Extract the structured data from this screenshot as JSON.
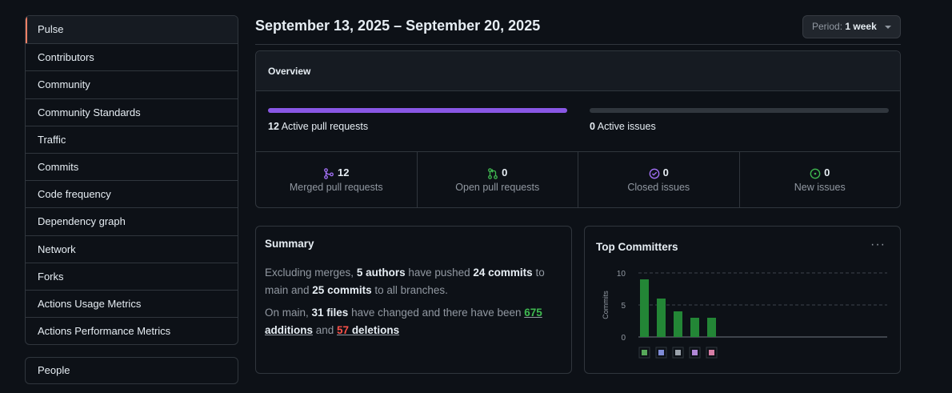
{
  "sidebar": {
    "items": [
      {
        "label": "Pulse",
        "active": true
      },
      {
        "label": "Contributors"
      },
      {
        "label": "Community"
      },
      {
        "label": "Community Standards"
      },
      {
        "label": "Traffic"
      },
      {
        "label": "Commits"
      },
      {
        "label": "Code frequency"
      },
      {
        "label": "Dependency graph"
      },
      {
        "label": "Network"
      },
      {
        "label": "Forks"
      },
      {
        "label": "Actions Usage Metrics"
      },
      {
        "label": "Actions Performance Metrics"
      }
    ],
    "people_label": "People"
  },
  "header": {
    "title": "September 13, 2025 – September 20, 2025",
    "period_prefix": "Period:",
    "period_value": "1 week"
  },
  "overview": {
    "title": "Overview",
    "pull_requests": {
      "count": "12",
      "label": "Active pull requests",
      "fill": 1.0,
      "color": "#8957e5"
    },
    "issues": {
      "count": "0",
      "label": "Active issues",
      "fill": 0,
      "color": "#30363d"
    },
    "stats": [
      {
        "count": "12",
        "label": "Merged pull requests",
        "icon": "merge-icon",
        "color": "#a371f7"
      },
      {
        "count": "0",
        "label": "Open pull requests",
        "icon": "pull-request-icon",
        "color": "#3fb950"
      },
      {
        "count": "0",
        "label": "Closed issues",
        "icon": "issue-closed-icon",
        "color": "#a371f7"
      },
      {
        "count": "0",
        "label": "New issues",
        "icon": "issue-open-icon",
        "color": "#3fb950"
      }
    ]
  },
  "summary": {
    "title": "Summary",
    "p1": {
      "t1": "Excluding merges, ",
      "authors": "5 authors",
      "t2": " have pushed ",
      "commits": "24 commits",
      "t3": " to main and ",
      "commits_all": "25 commits",
      "t4": " to all branches."
    },
    "p2": {
      "t1": "On main, ",
      "files": "31 files",
      "t2": " have changed and there have been ",
      "additions_num": "675",
      "additions_word": " additions",
      "t3": " and ",
      "deletions_num": "57",
      "deletions_word": " deletions"
    }
  },
  "committers": {
    "title": "Top Committers",
    "menu_icon": "kebab-icon",
    "chart_data": {
      "type": "bar",
      "categories": [
        "",
        "",
        "",
        "",
        ""
      ],
      "values": [
        9,
        6,
        4,
        3,
        3
      ],
      "ylabel": "Commits",
      "yticks": [
        "0",
        "5",
        "10"
      ],
      "ylim": [
        0,
        10
      ],
      "grid": true,
      "bar_color": "#238636",
      "avatar_colors": [
        "#57a85a",
        "#7f8cd6",
        "#9aa2ab",
        "#b087d6",
        "#d67ea5"
      ]
    }
  }
}
